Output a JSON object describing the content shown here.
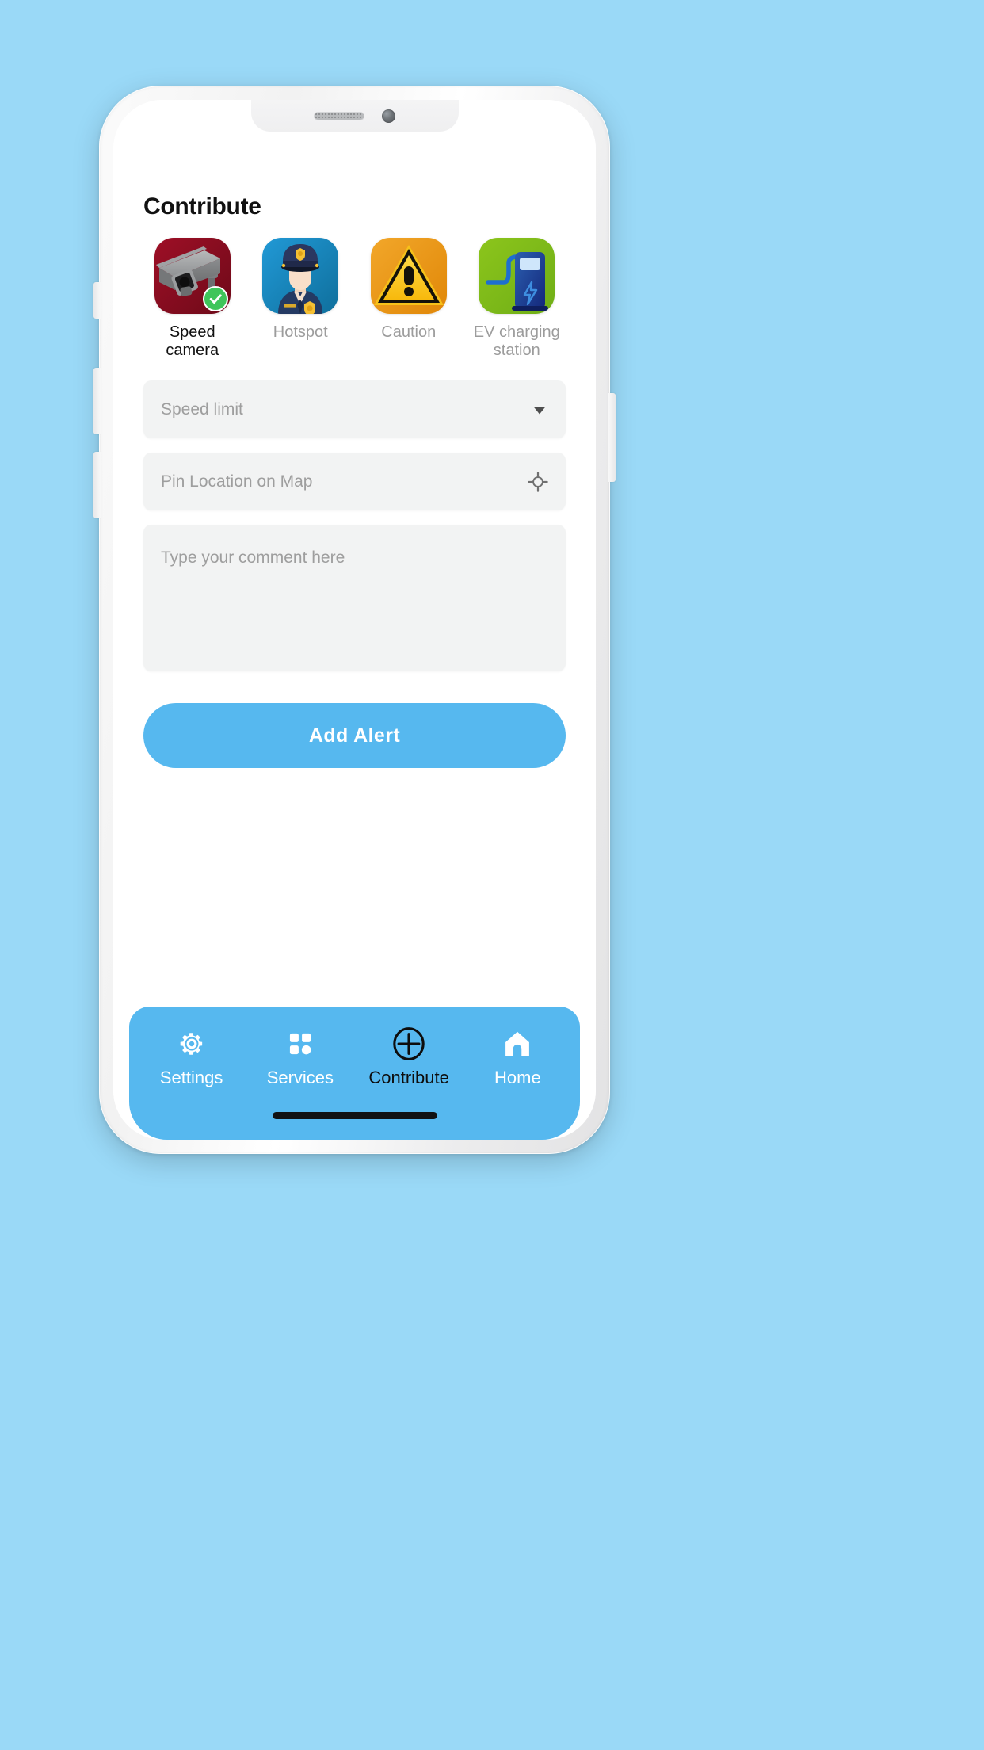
{
  "app": {
    "page_title": "Contribute",
    "accent_color": "#56b8ef",
    "background_color": "#9ad9f7"
  },
  "categories": [
    {
      "label": "Speed camera",
      "icon": "speed-camera-icon",
      "selected": true,
      "tile_color": "#8c0d22",
      "badge": "check-badge"
    },
    {
      "label": "Hotspot",
      "icon": "police-officer-icon",
      "selected": false,
      "tile_color": "#1789c4"
    },
    {
      "label": "Caution",
      "icon": "warning-triangle-icon",
      "selected": false,
      "tile_color": "#ef9a1b"
    },
    {
      "label": "EV charging station",
      "icon": "ev-charging-station-icon",
      "selected": false,
      "tile_color": "#80bd1f"
    }
  ],
  "form": {
    "speed_limit": {
      "placeholder": "Speed limit",
      "value": "",
      "icon": "chevron-down-icon"
    },
    "pin_location": {
      "placeholder": "Pin Location on Map",
      "value": "",
      "icon": "crosshair-location-icon"
    },
    "comment": {
      "placeholder": "Type your comment here",
      "value": ""
    },
    "submit_label": "Add Alert"
  },
  "navbar": {
    "items": [
      {
        "label": "Settings",
        "icon": "gear-icon",
        "active": false
      },
      {
        "label": "Services",
        "icon": "grid-apps-icon",
        "active": false
      },
      {
        "label": "Contribute",
        "icon": "plus-circle-icon",
        "active": true
      },
      {
        "label": "Home",
        "icon": "house-icon",
        "active": false
      }
    ]
  }
}
